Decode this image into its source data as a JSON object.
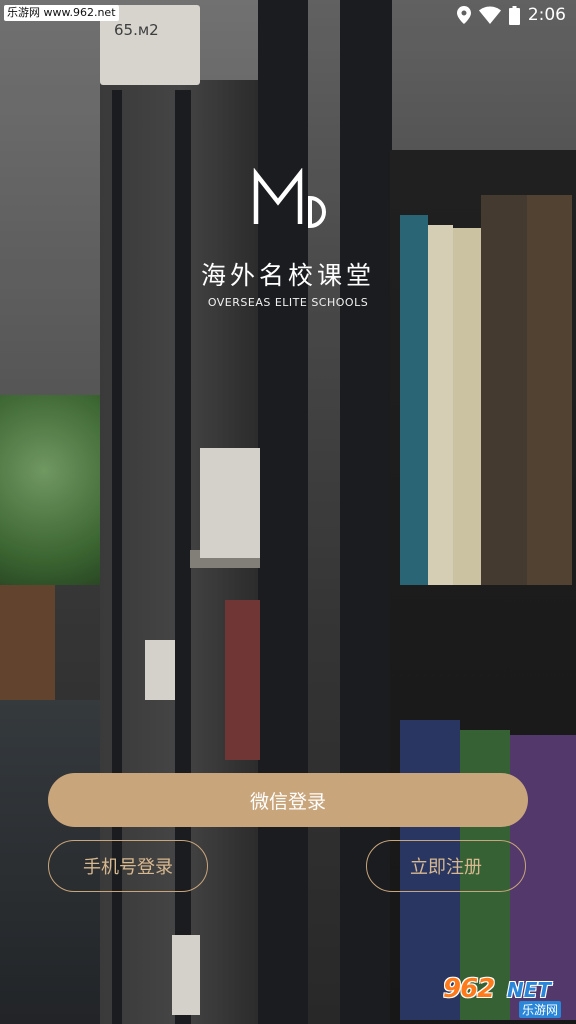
{
  "status_bar": {
    "watermark": "乐游网 www.962.net",
    "time": "2:06",
    "icons": [
      "location-icon",
      "wifi-icon",
      "battery-icon"
    ]
  },
  "background": {
    "shelf_sign": "65.м2"
  },
  "brand": {
    "logo_icon": "md-monogram-logo",
    "title": "海外名校课堂",
    "subtitle": "OVERSEAS ELITE SCHOOLS"
  },
  "actions": {
    "wechat_login": "微信登录",
    "phone_login": "手机号登录",
    "register": "立即注册"
  },
  "watermark_br": {
    "num": "962",
    "net": "NET",
    "name": "乐游网"
  },
  "colors": {
    "accent": "#c9a57b",
    "text": "#ffffff"
  }
}
